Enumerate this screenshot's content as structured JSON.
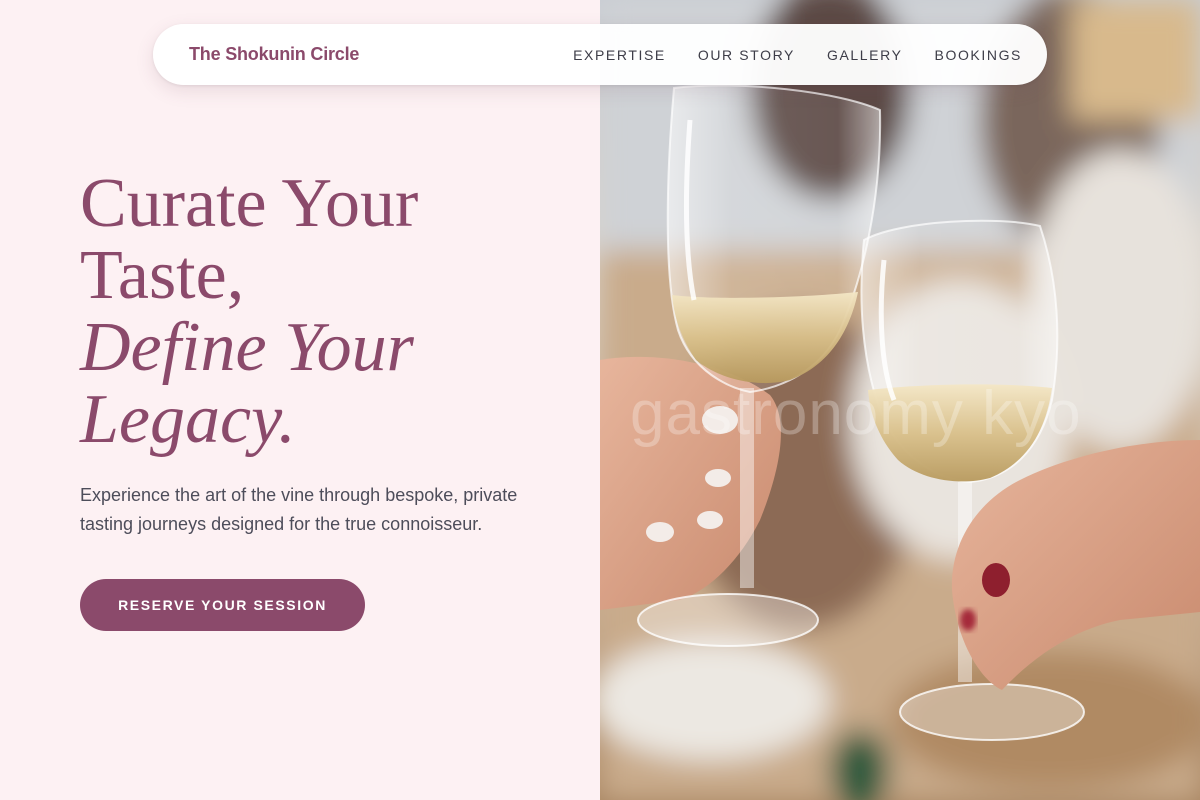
{
  "nav": {
    "brand": "The Shokunin Circle",
    "links": [
      "EXPERTISE",
      "OUR STORY",
      "GALLERY",
      "BOOKINGS"
    ]
  },
  "hero": {
    "title_lines": [
      "Curate Your",
      "Taste,"
    ],
    "title_italic_lines": [
      "Define Your",
      "Legacy."
    ],
    "subtitle": "Experience the art of the vine through bespoke, private tasting journeys designed for the true connoisseur.",
    "cta_label": "RESERVE YOUR SESSION"
  },
  "photo": {
    "watermark": "gastronomy kyo"
  },
  "colors": {
    "accent": "#8b4a6b",
    "background": "#fdf1f3",
    "body_text": "#4d4d5a"
  }
}
